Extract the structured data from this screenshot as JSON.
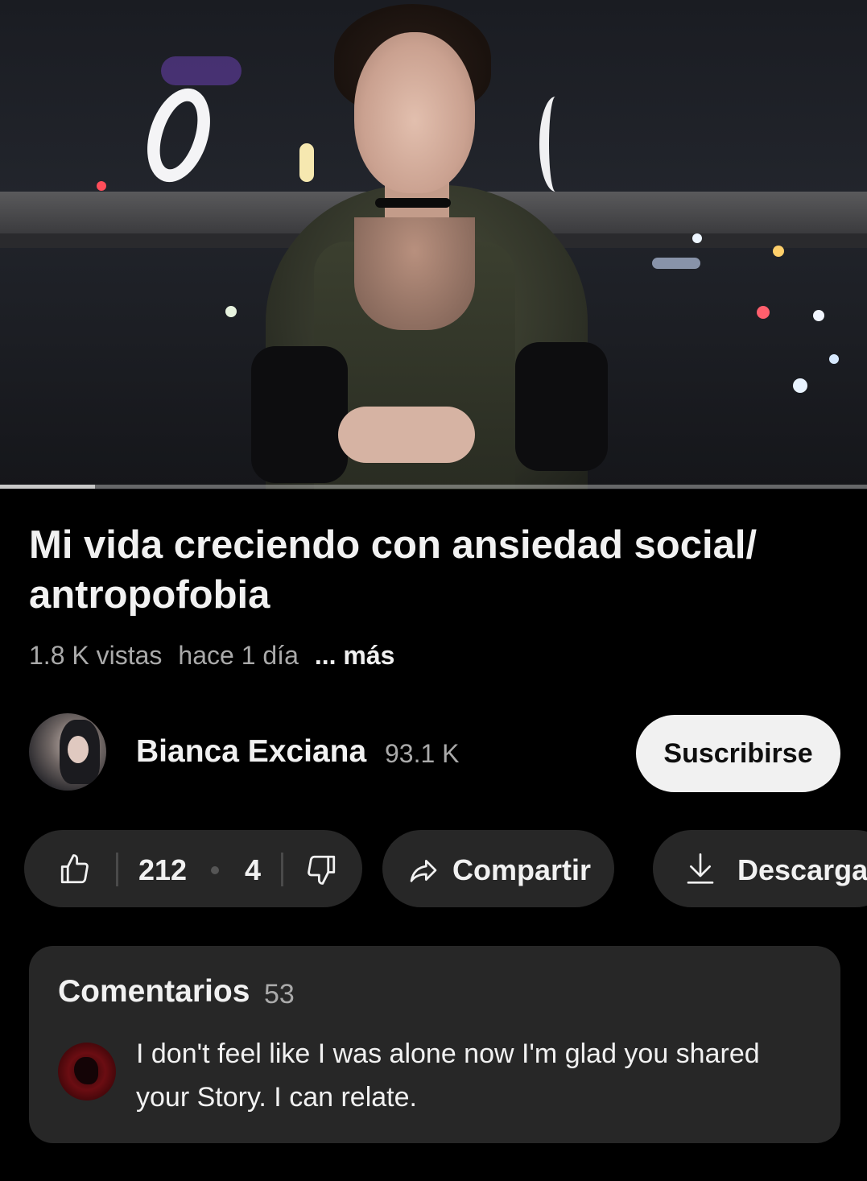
{
  "video": {
    "title": "Mi vida creciendo con ansiedad social/ antropofobia",
    "views": "1.8 K vistas",
    "age": "hace 1 día",
    "more_label": "... más",
    "progress_percent": 11
  },
  "channel": {
    "name": "Bianca Exciana",
    "subscribers": "93.1 K",
    "subscribe_label": "Suscribirse"
  },
  "actions": {
    "likes": "212",
    "dislikes": "4",
    "share_label": "Compartir",
    "download_label": "Descargar",
    "like_icon": "thumbs-up-icon",
    "dislike_icon": "thumbs-down-icon",
    "share_icon": "share-arrow-icon",
    "download_icon": "download-icon"
  },
  "comments": {
    "title": "Comentarios",
    "count": "53",
    "top_comment": "I don't feel like I was alone now I'm glad you shared your Story.  I can relate."
  },
  "colors": {
    "background": "#000000",
    "pill": "#272727",
    "text_primary": "#f1f1f1",
    "text_secondary": "#aaaaaa",
    "subscribe_bg": "#f1f1f1"
  }
}
